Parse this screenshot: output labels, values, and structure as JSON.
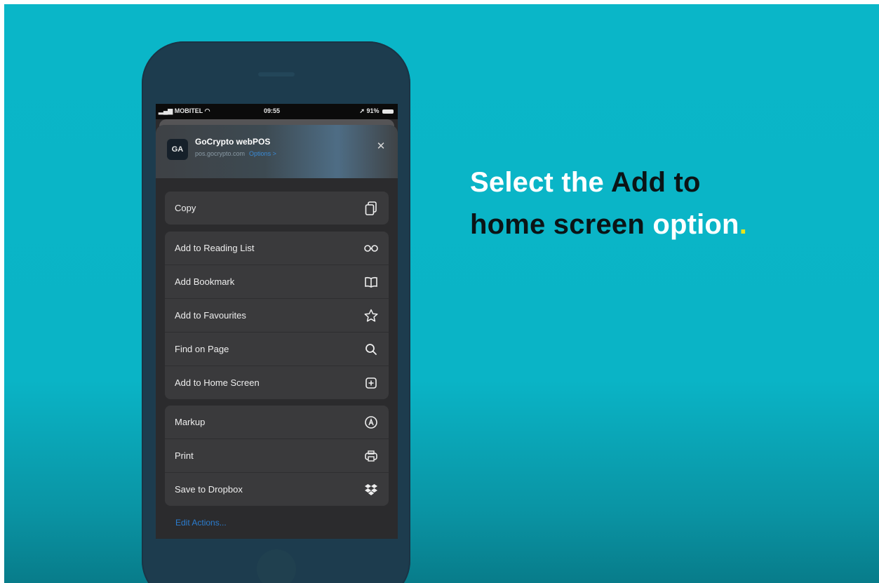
{
  "status_bar": {
    "carrier": "MOBITEL",
    "time": "09:55",
    "battery": "91%"
  },
  "app": {
    "name": "GoCrypto webPOS",
    "url": "pos.gocrypto.com",
    "options": "Options >",
    "icon_text": "GA"
  },
  "menu": {
    "group1": [
      {
        "label": "Copy",
        "icon": "copy-icon"
      }
    ],
    "group2": [
      {
        "label": "Add to Reading List",
        "icon": "glasses-icon"
      },
      {
        "label": "Add Bookmark",
        "icon": "book-icon"
      },
      {
        "label": "Add to Favourites",
        "icon": "star-icon"
      },
      {
        "label": "Find on Page",
        "icon": "search-icon"
      },
      {
        "label": "Add to Home Screen",
        "icon": "plus-square-icon"
      }
    ],
    "group3": [
      {
        "label": "Markup",
        "icon": "markup-icon"
      },
      {
        "label": "Print",
        "icon": "printer-icon"
      },
      {
        "label": "Save to Dropbox",
        "icon": "dropbox-icon"
      }
    ],
    "edit_actions": "Edit Actions..."
  },
  "headline": {
    "part1": "Select the",
    "part2": "Add to",
    "part3": "home screen",
    "part4": "option",
    "part5": "."
  },
  "colors": {
    "background": "#0ab6c8",
    "accent_dot": "#e9e51a",
    "link": "#2b7ccf"
  }
}
